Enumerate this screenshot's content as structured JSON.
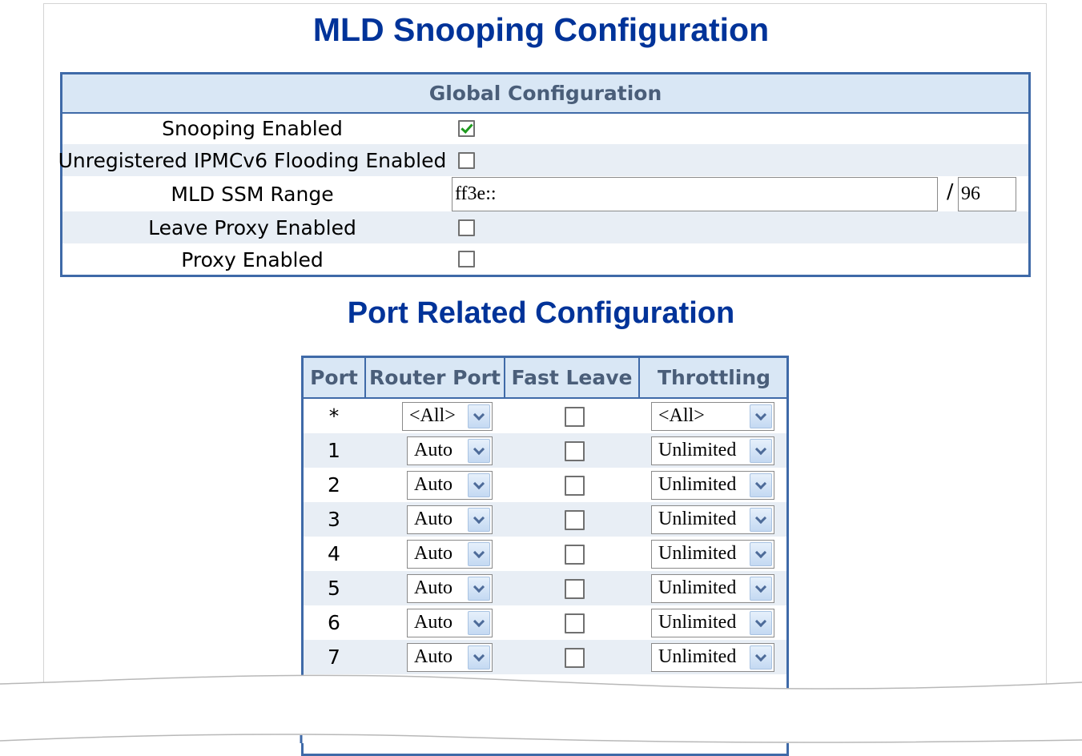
{
  "page_title": "MLD Snooping Configuration",
  "global": {
    "header": "Global Configuration",
    "snooping_enabled": {
      "label": "Snooping Enabled",
      "checked": true
    },
    "unregistered_flooding": {
      "label": "Unregistered IPMCv6 Flooding Enabled",
      "checked": false
    },
    "ssm_range": {
      "label": "MLD SSM Range",
      "address": "ff3e::",
      "separator": "/",
      "prefix_length": "96"
    },
    "leave_proxy_enabled": {
      "label": "Leave Proxy Enabled",
      "checked": false
    },
    "proxy_enabled": {
      "label": "Proxy Enabled",
      "checked": false
    }
  },
  "port_section_title": "Port Related Configuration",
  "port_table": {
    "headers": {
      "port": "Port",
      "router_port": "Router Port",
      "fast_leave": "Fast Leave",
      "throttling": "Throttling"
    },
    "rows": [
      {
        "port": "*",
        "router_port": "<All>",
        "fast_leave": false,
        "throttling": "<All>"
      },
      {
        "port": "1",
        "router_port": "Auto",
        "fast_leave": false,
        "throttling": "Unlimited"
      },
      {
        "port": "2",
        "router_port": "Auto",
        "fast_leave": false,
        "throttling": "Unlimited"
      },
      {
        "port": "3",
        "router_port": "Auto",
        "fast_leave": false,
        "throttling": "Unlimited"
      },
      {
        "port": "4",
        "router_port": "Auto",
        "fast_leave": false,
        "throttling": "Unlimited"
      },
      {
        "port": "5",
        "router_port": "Auto",
        "fast_leave": false,
        "throttling": "Unlimited"
      },
      {
        "port": "6",
        "router_port": "Auto",
        "fast_leave": false,
        "throttling": "Unlimited"
      },
      {
        "port": "7",
        "router_port": "Auto",
        "fast_leave": false,
        "throttling": "Unlimited"
      }
    ]
  },
  "colors": {
    "title": "#003399",
    "table_border": "#3f6aa8",
    "header_bg": "#d9e7f5",
    "alt_row": "#e8eef5",
    "check": "#1f9a1f"
  }
}
